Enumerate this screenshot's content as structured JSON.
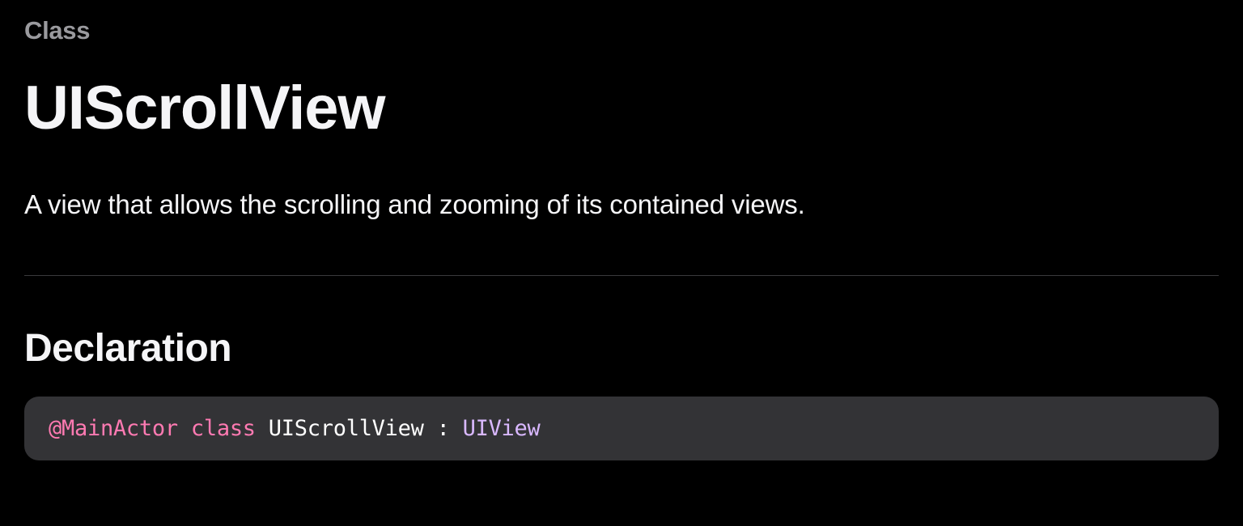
{
  "header": {
    "type_label": "Class",
    "title": "UIScrollView",
    "description": "A view that allows the scrolling and zooming of its contained views."
  },
  "declaration": {
    "heading": "Declaration",
    "tokens": {
      "attribute": "@MainActor",
      "keyword": "class",
      "name": "UIScrollView",
      "colon": " : ",
      "inherits": "UIView"
    }
  }
}
